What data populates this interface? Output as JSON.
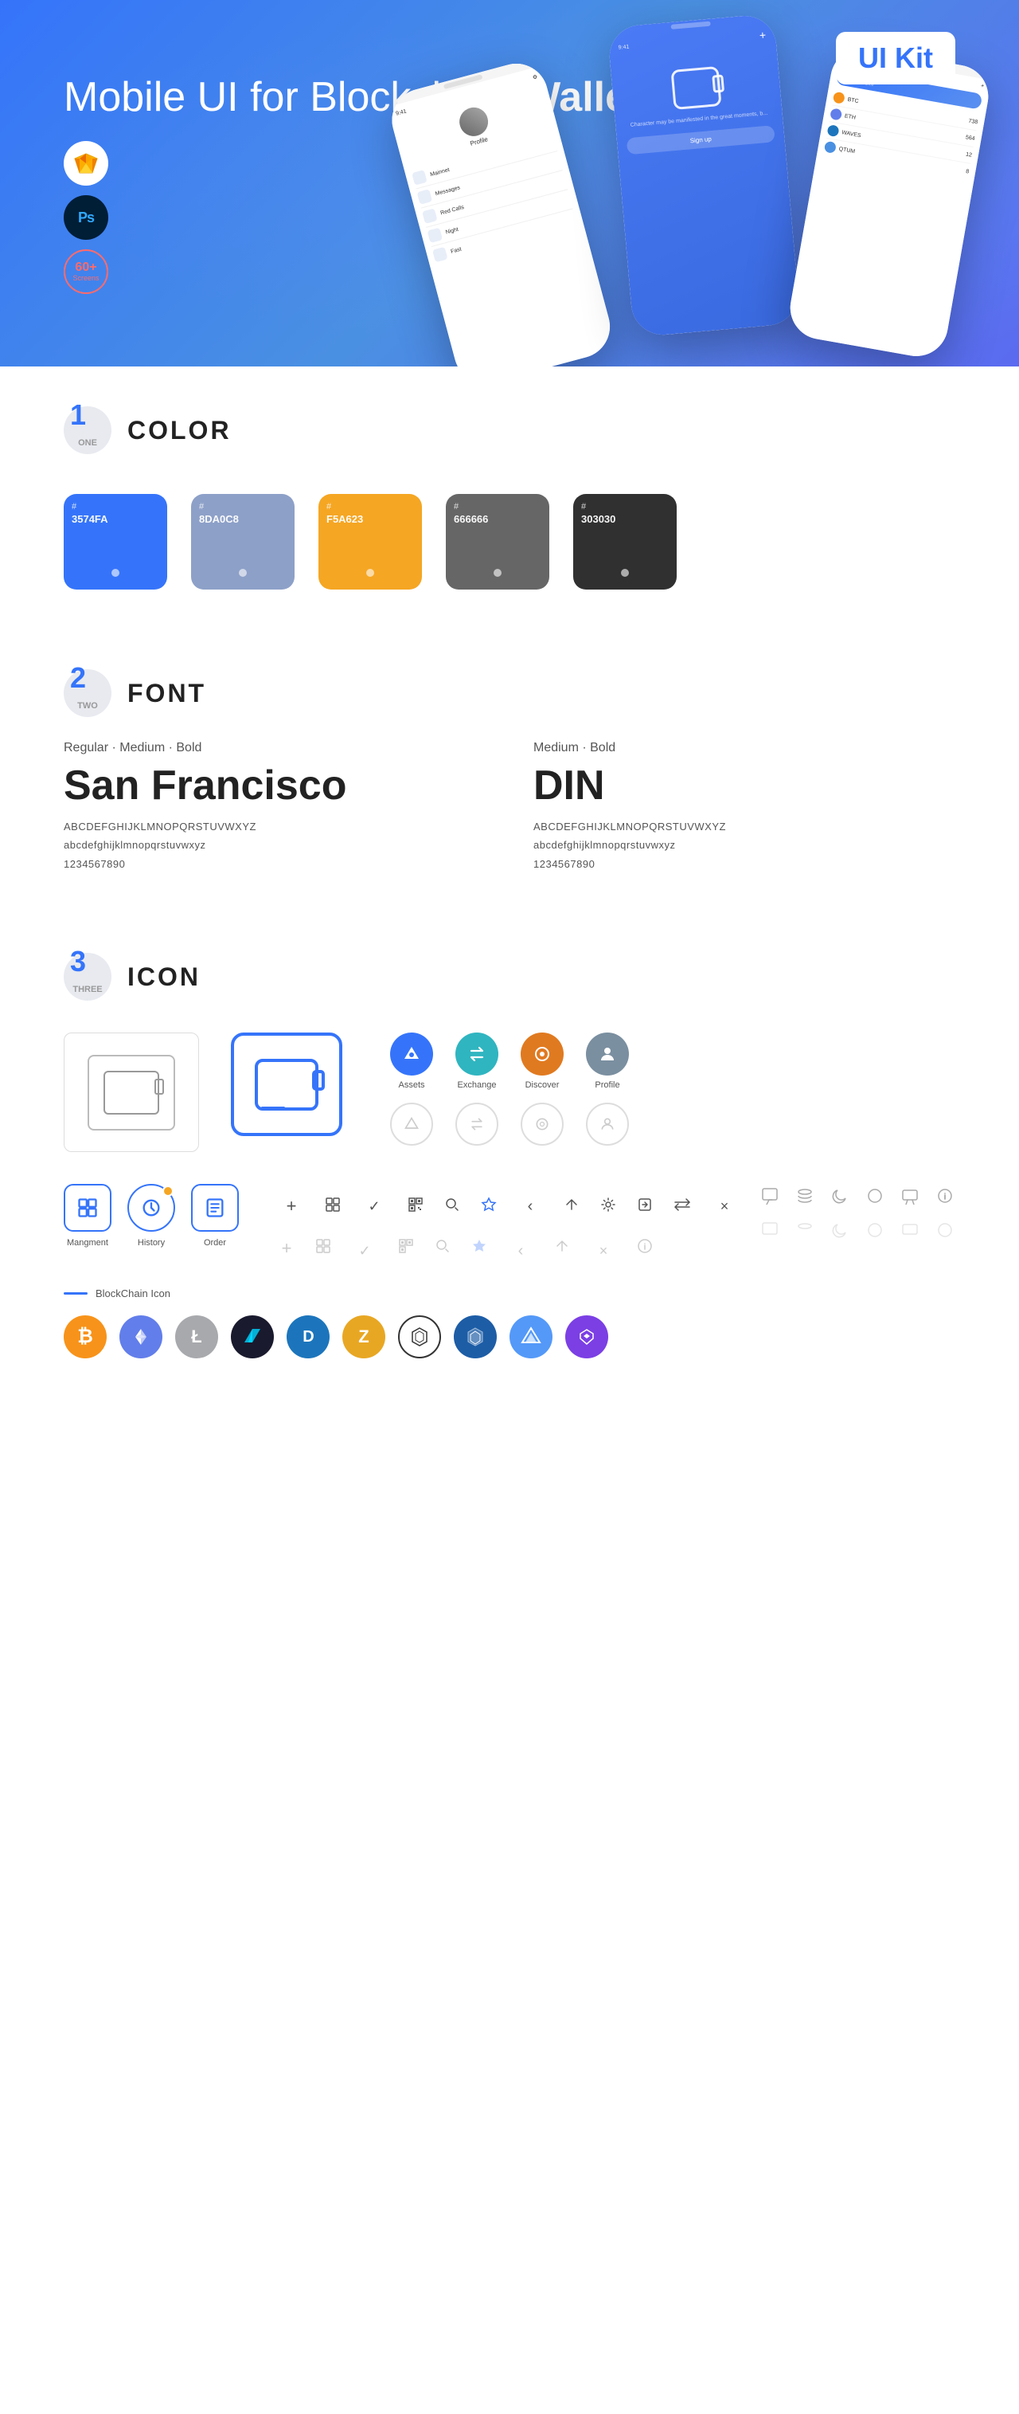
{
  "hero": {
    "title_normal": "Mobile UI for Blockchain ",
    "title_bold": "Wallet",
    "badge_ui_kit": "UI Kit",
    "badge_sketch": "◈",
    "badge_ps": "Ps",
    "badge_screens_num": "60+",
    "badge_screens_lbl": "Screens"
  },
  "section1": {
    "num": "1",
    "sub": "ONE",
    "title": "COLOR",
    "colors": [
      {
        "hex": "#3574FA",
        "label": "#\n3574FA"
      },
      {
        "hex": "#8DA0C8",
        "label": "#\n8DA0C8"
      },
      {
        "hex": "#F5A623",
        "label": "#\nF5A623"
      },
      {
        "hex": "#666666",
        "label": "#\n666666"
      },
      {
        "hex": "#303030",
        "label": "#\n303030"
      }
    ]
  },
  "section2": {
    "num": "2",
    "sub": "TWO",
    "title": "FONT",
    "left": {
      "meta": "Regular · Medium · Bold",
      "name": "San Francisco",
      "upper": "ABCDEFGHIJKLMNOPQRSTUVWXYZ",
      "lower": "abcdefghijklmnopqrstuvwxyz",
      "nums": "1234567890"
    },
    "right": {
      "meta": "Medium · Bold",
      "name": "DIN",
      "upper": "ABCDEFGHIJKLMNOPQRSTUVWXYZ",
      "lower": "abcdefghijklmnopqrstuvwxyz",
      "nums": "1234567890"
    }
  },
  "section3": {
    "num": "3",
    "sub": "THREE",
    "title": "ICON",
    "nav_icons": [
      {
        "label": "Assets",
        "color": "blue",
        "symbol": "◆"
      },
      {
        "label": "Exchange",
        "color": "teal",
        "symbol": "⇄"
      },
      {
        "label": "Discover",
        "color": "orange",
        "symbol": "◉"
      },
      {
        "label": "Profile",
        "color": "gray",
        "symbol": "⌂"
      }
    ],
    "bottom_icons": [
      {
        "label": "Mangment",
        "type": "box"
      },
      {
        "label": "History",
        "type": "clock"
      },
      {
        "label": "Order",
        "type": "list"
      }
    ],
    "misc_icons": [
      "+",
      "⊞",
      "✓",
      "⊟",
      "⌕",
      "☆",
      "‹",
      "⟨",
      "✕",
      "⚙",
      "⊡",
      "⊘",
      "×"
    ],
    "blockchain_label": "BlockChain Icon",
    "crypto": [
      {
        "symbol": "₿",
        "bg": "#f7931a",
        "color": "#fff",
        "label": "BTC"
      },
      {
        "symbol": "Ξ",
        "bg": "#627eea",
        "color": "#fff",
        "label": "ETH"
      },
      {
        "symbol": "Ł",
        "bg": "#bfbbbb",
        "color": "#fff",
        "label": "LTC"
      },
      {
        "symbol": "◈",
        "bg": "#1c1c3a",
        "color": "#00d4ff",
        "label": "WINGS"
      },
      {
        "symbol": "D",
        "bg": "#1c75bc",
        "color": "#fff",
        "label": "DASH"
      },
      {
        "symbol": "Z",
        "bg": "#e8a723",
        "color": "#fff",
        "label": "ZCASH"
      },
      {
        "symbol": "⬡",
        "bg": "#fff",
        "color": "#333",
        "label": "IOTA",
        "border": true
      },
      {
        "symbol": "⬡",
        "bg": "#1f6fb2",
        "color": "#fff",
        "label": "STRATIS"
      },
      {
        "symbol": "▲",
        "bg": "#f4a460",
        "color": "#fff",
        "label": "NAV"
      },
      {
        "symbol": "P",
        "bg": "#8247e5",
        "color": "#fff",
        "label": "MATIC"
      }
    ]
  }
}
